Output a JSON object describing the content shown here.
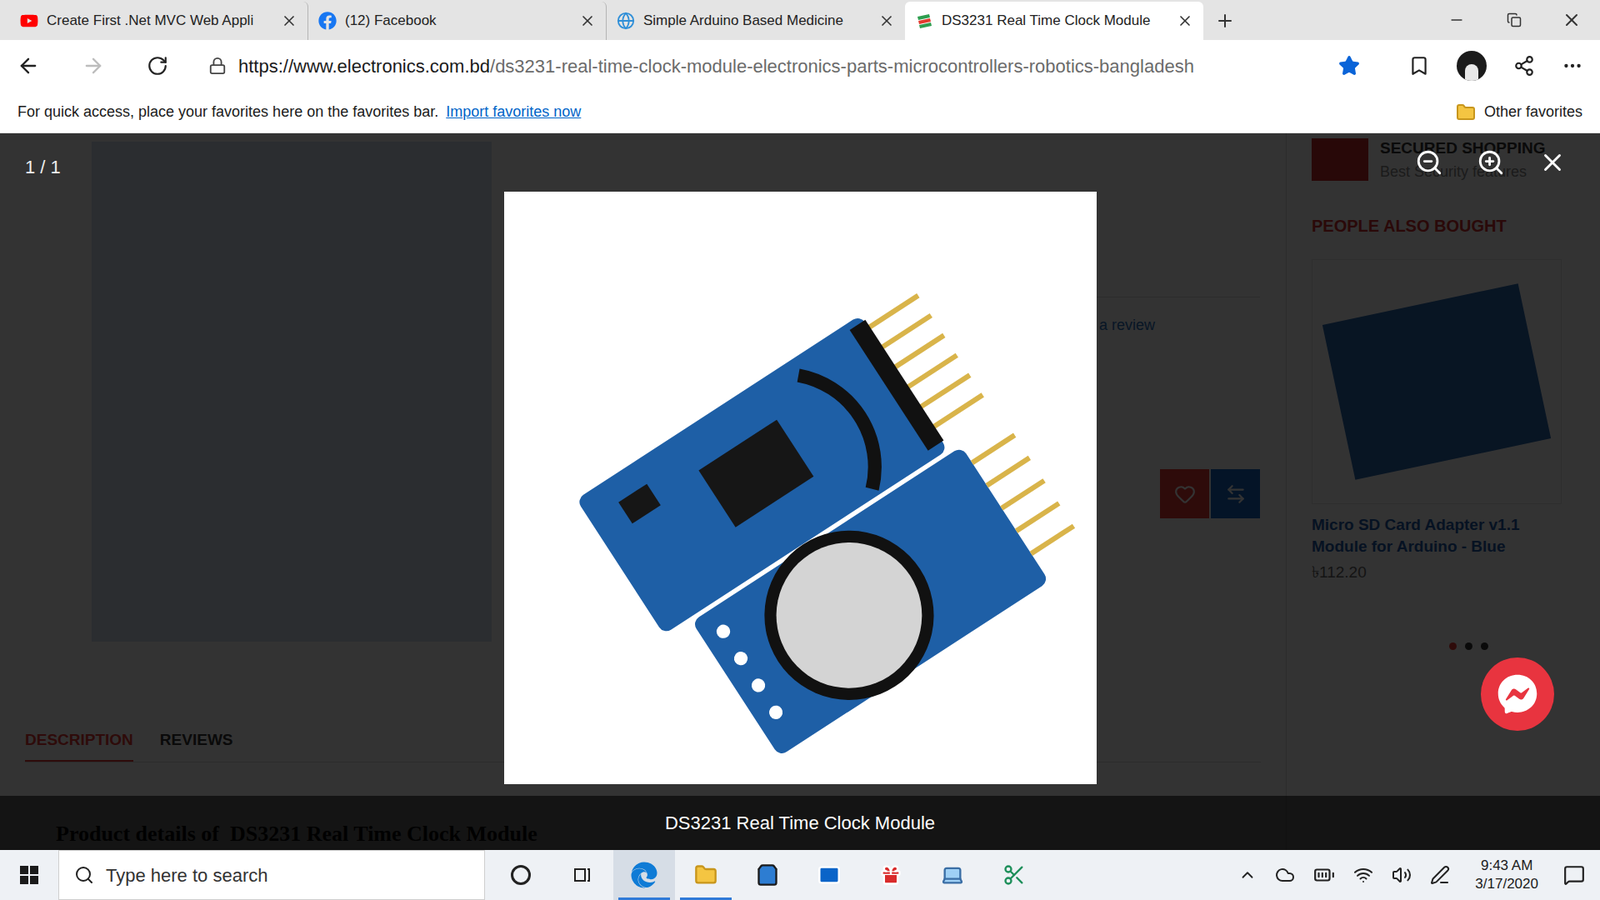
{
  "browser": {
    "tabs": [
      {
        "title": "Create First .Net MVC Web Appli",
        "selected": false,
        "icon": "youtube"
      },
      {
        "title": "(12) Facebook",
        "selected": false,
        "icon": "facebook"
      },
      {
        "title": "Simple Arduino Based Medicine",
        "selected": false,
        "icon": "globe"
      },
      {
        "title": "DS3231 Real Time Clock Module",
        "selected": true,
        "icon": "shop"
      }
    ],
    "address": {
      "host": "https://www.electronics.com.bd",
      "path": "/ds3231-real-time-clock-module-electronics-parts-microcontrollers-robotics-bangladesh"
    },
    "favorited": true
  },
  "favorites_bar": {
    "message": "For quick access, place your favorites here on the favorites bar.",
    "link": "Import favorites now",
    "folder": "Other favorites"
  },
  "page": {
    "sidebar": {
      "badge_title": "SECURED SHOPPING",
      "badge_text": "Best Security features",
      "section_title": "PEOPLE ALSO BOUGHT",
      "product": {
        "name": "Micro SD Card Adapter v1.1 Module for Arduino - Blue",
        "price": "৳112.20"
      },
      "dots": [
        {
          "selected": true
        },
        {
          "selected": false
        },
        {
          "selected": false
        }
      ]
    },
    "review_link": "a review",
    "tabs": [
      {
        "label": "DESCRIPTION",
        "selected": true
      },
      {
        "label": "REVIEWS",
        "selected": false
      }
    ],
    "details_heading": "Product details of  DS3231 Real Time Clock Module"
  },
  "lightbox": {
    "counter": "1 / 1",
    "caption": "DS3231 Real Time Clock Module"
  },
  "taskbar": {
    "search_placeholder": "Type here to search",
    "time": "9:43 AM",
    "date": "3/17/2020",
    "apps": [
      {
        "kind": "cortana",
        "open": false,
        "selected": false
      },
      {
        "kind": "task-view",
        "open": false,
        "selected": false
      },
      {
        "kind": "edge",
        "open": true,
        "selected": true
      },
      {
        "kind": "file-explorer",
        "open": true,
        "selected": false
      },
      {
        "kind": "store",
        "open": false,
        "selected": false
      },
      {
        "kind": "mail",
        "open": false,
        "selected": false
      },
      {
        "kind": "gift",
        "open": false,
        "selected": false
      },
      {
        "kind": "laptop",
        "open": false,
        "selected": false
      },
      {
        "kind": "snip",
        "open": false,
        "selected": false
      }
    ]
  }
}
